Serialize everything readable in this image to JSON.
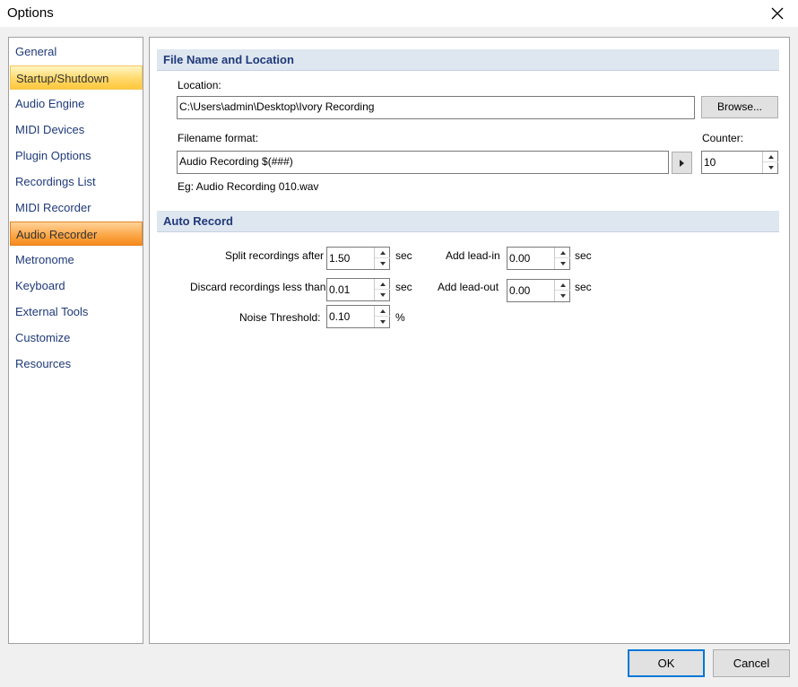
{
  "window": {
    "title": "Options",
    "close_icon": "close-icon"
  },
  "sidebar": {
    "items": [
      {
        "label": "General",
        "state": "normal"
      },
      {
        "label": "Startup/Shutdown",
        "state": "hover"
      },
      {
        "label": "Audio Engine",
        "state": "normal"
      },
      {
        "label": "MIDI Devices",
        "state": "normal"
      },
      {
        "label": "Plugin Options",
        "state": "normal"
      },
      {
        "label": "Recordings List",
        "state": "normal"
      },
      {
        "label": "MIDI Recorder",
        "state": "normal"
      },
      {
        "label": "Audio Recorder",
        "state": "selected"
      },
      {
        "label": "Metronome",
        "state": "normal"
      },
      {
        "label": "Keyboard",
        "state": "normal"
      },
      {
        "label": "External Tools",
        "state": "normal"
      },
      {
        "label": "Customize",
        "state": "normal"
      },
      {
        "label": "Resources",
        "state": "normal"
      }
    ]
  },
  "file_section": {
    "header": "File Name and Location",
    "location_label": "Location:",
    "location_value": "C:\\Users\\admin\\Desktop\\Ivory Recording",
    "browse_label": "Browse...",
    "filename_label": "Filename format:",
    "filename_value": "Audio Recording $(###)",
    "counter_label": "Counter:",
    "counter_value": "10",
    "example_text": "Eg: Audio Recording 010.wav"
  },
  "auto_record": {
    "header": "Auto Record",
    "split_label": "Split recordings after",
    "split_value": "1.50",
    "split_unit": "sec",
    "discard_label": "Discard recordings less than",
    "discard_value": "0.01",
    "discard_unit": "sec",
    "noise_label": "Noise Threshold:",
    "noise_value": "0.10",
    "noise_unit": "%",
    "leadin_label": "Add lead-in",
    "leadin_value": "0.00",
    "leadin_unit": "sec",
    "leadout_label": "Add lead-out",
    "leadout_value": "0.00",
    "leadout_unit": "sec"
  },
  "footer": {
    "ok_label": "OK",
    "cancel_label": "Cancel"
  },
  "colors": {
    "accent": "#0078d7",
    "selected": "#fca84a",
    "hover": "#ffd96b",
    "nav_text": "#1f3a7a"
  }
}
